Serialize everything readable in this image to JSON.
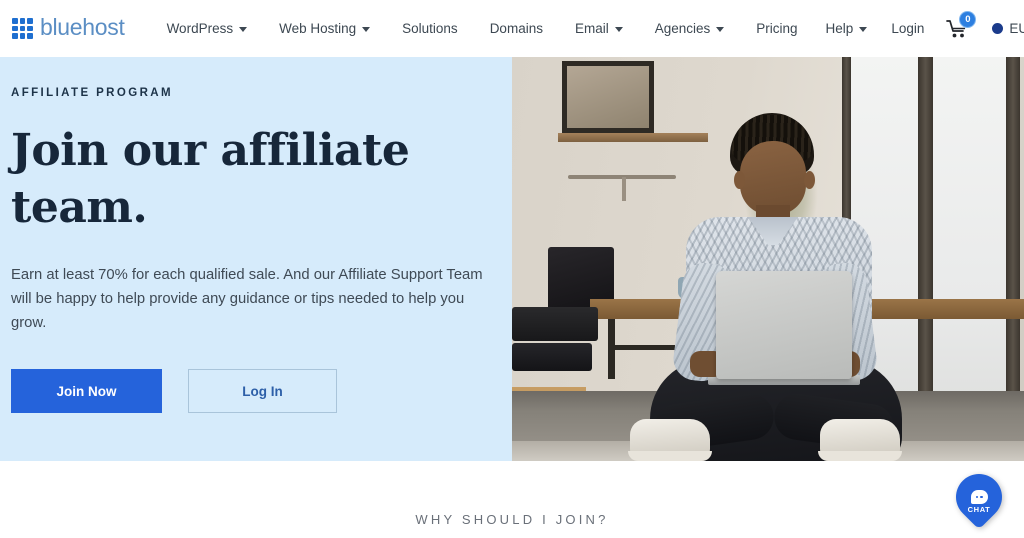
{
  "header": {
    "brand": {
      "name": "bluehost",
      "icon": "grid-logo-icon"
    },
    "nav": [
      {
        "label": "WordPress",
        "has_caret": true
      },
      {
        "label": "Web Hosting",
        "has_caret": true
      },
      {
        "label": "Solutions",
        "has_caret": false
      },
      {
        "label": "Domains",
        "has_caret": false
      },
      {
        "label": "Email",
        "has_caret": true
      },
      {
        "label": "Agencies",
        "has_caret": true
      },
      {
        "label": "Pricing",
        "has_caret": false
      }
    ],
    "help_label": "Help",
    "login_label": "Login",
    "cart": {
      "icon": "shopping-cart-icon",
      "count": "0"
    },
    "currency": {
      "label": "EUR",
      "icon": "globe-icon"
    }
  },
  "hero": {
    "eyebrow": "AFFILIATE PROGRAM",
    "title": "Join our affiliate team.",
    "subtitle": "Earn at least 70% for each qualified sale. And our Affiliate Support Team will be happy to help provide any guidance or tips needed to help you grow.",
    "primary_cta": "Join Now",
    "secondary_cta": "Log In",
    "background_color": "#d6ebfb",
    "primary_cta_color": "#2563db"
  },
  "section": {
    "why_title": "WHY SHOULD I JOIN?"
  },
  "chat_widget": {
    "label": "CHAT",
    "icon": "chat-bubble-icon",
    "color": "#2563db"
  }
}
